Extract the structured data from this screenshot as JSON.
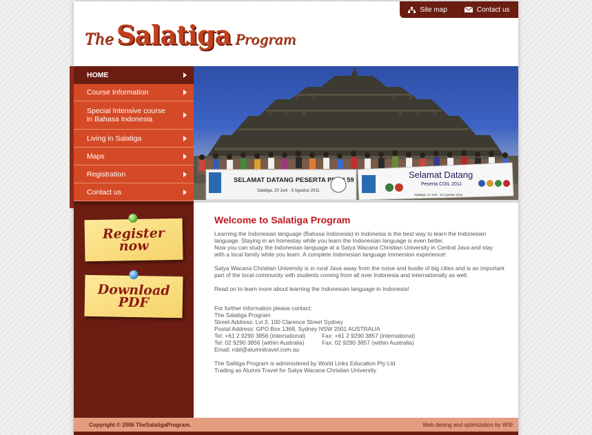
{
  "topbar": {
    "sitemap": "Site map",
    "contact": "Contact us"
  },
  "logo": {
    "the": "The",
    "name": "Salatiga",
    "program": "Program"
  },
  "nav": [
    {
      "label": "HOME"
    },
    {
      "label": "Course Information"
    },
    {
      "label": "Special Intensive course\nin Bahasa Indonesia"
    },
    {
      "label": "Living in Salatiga"
    },
    {
      "label": "Maps"
    },
    {
      "label": "Registration"
    },
    {
      "label": "Contact us"
    }
  ],
  "notes": {
    "register_line1": "Register",
    "register_line2": "now",
    "download_line1": "Download",
    "download_line2": "PDF"
  },
  "banner": {
    "left_text": "SELAMAT DATANG PESERTA PIBBI 59",
    "left_sub": "Salatiga, 20 Juni - 5 Agustus 2011",
    "right_text": "Selamat Datang",
    "right_sub": "Peserta COIL 2011",
    "right_date": "Salatiga, 17 Juni - 12 Agustus 2011"
  },
  "content": {
    "title": "Welcome to Salatiga Program",
    "p1": "Learning the Indonesian language (Bahasa Indonesia) in Indonesia is the best way to learn the Indonesian language. Staying in an homestay while you learn the Indonesian language is even better.",
    "p1b": "Now you can study the Indonesian language at a Satya Wacana Christian University in Central Java and stay with a local family while you learn. A complete Indonesian language immersion experience!",
    "p2": "Satya Wacana Christian University is in rural Java away from the noise and bustle of big cities and is an important part of the local community with students coming from all over Indonesia and internationally as well.",
    "p3": "Read on to learn more about learning the Indonesian language in Indonesia!",
    "contact_intro": "For further information please contact:",
    "org": "The Salatiga Program",
    "street": "Street Address: Lvl 3, 100 Clarence Street Sydney",
    "postal": "Postal Address: GPO Box 1368, Sydney NSW 2001 AUSTRALIA",
    "tel_intl": "Tel: +61 2 9290 3856 (international)",
    "fax_intl": "Fax: +61 2 9290 3857 (international)",
    "tel_local": "Tel: 02 9290 3856 (within Australia)",
    "fax_local": "Fax: 02 9290 3857 (within Australia)",
    "email": "Email: robl@alumnitravel.com.au",
    "admin1": "The Salitiga Program is administered by World Links Education Pty Ltd",
    "admin2": "Trading as Alumni Travel for Satya Wacana Christian University"
  },
  "footer": {
    "copyright": "Copyright © 2006 TheSalatigaProgram.",
    "credit": "Web desing and optimization by WSI"
  }
}
